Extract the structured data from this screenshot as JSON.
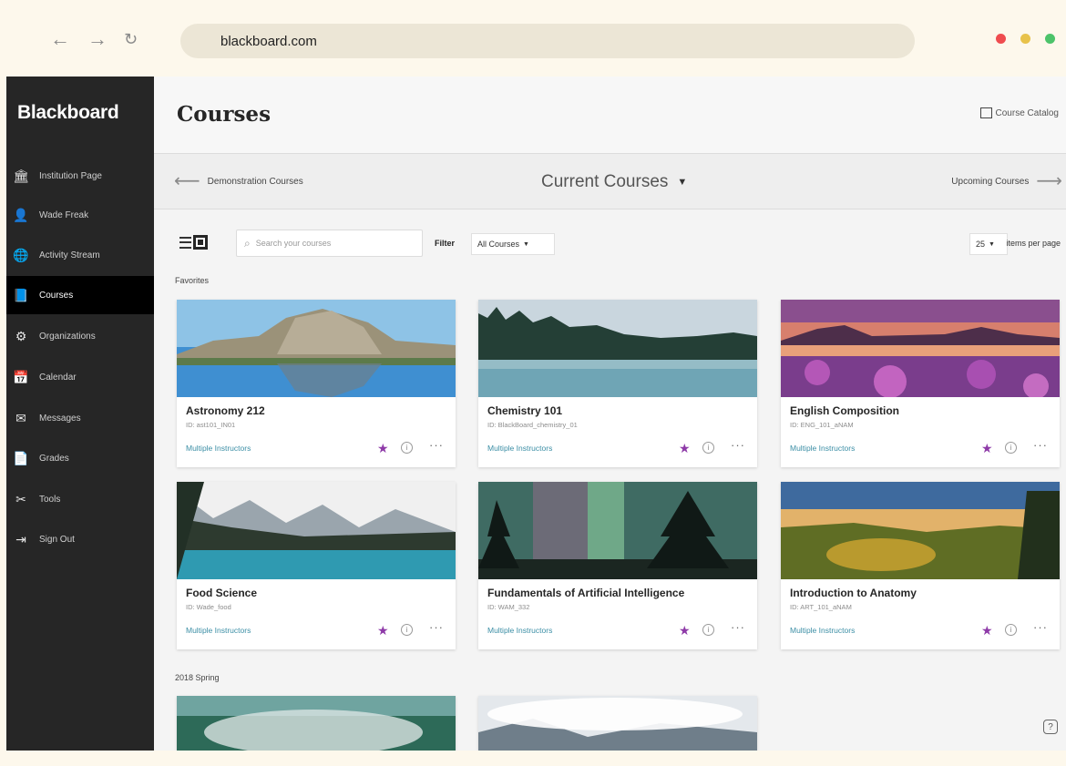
{
  "browser": {
    "url": "blackboard.com",
    "back_icon": "←",
    "forward_icon": "→",
    "reload_icon": "↻",
    "dot_colors": [
      "#ef4c4f",
      "#e8c24a",
      "#4cc36a"
    ]
  },
  "sidebar": {
    "brand": "Blackboard",
    "items": [
      {
        "label": "Institution Page",
        "icon": "🏛"
      },
      {
        "label": "Wade Freak",
        "icon": "👤"
      },
      {
        "label": "Activity Stream",
        "icon": "🌐"
      },
      {
        "label": "Courses",
        "icon": "📘"
      },
      {
        "label": "Organizations",
        "icon": "⚙"
      },
      {
        "label": "Calendar",
        "icon": "📅"
      },
      {
        "label": "Messages",
        "icon": "✉"
      },
      {
        "label": "Grades",
        "icon": "📄"
      },
      {
        "label": "Tools",
        "icon": "✂"
      },
      {
        "label": "Sign Out",
        "icon": "⇥"
      }
    ],
    "active_index": 3
  },
  "header": {
    "title": "Courses",
    "catalog_label": "Course Catalog"
  },
  "termbar": {
    "prev_label": "Demonstration Courses",
    "current_label": "Current Courses",
    "next_label": "Upcoming Courses"
  },
  "toolbar": {
    "search_placeholder": "Search your courses",
    "filter_label": "Filter",
    "filter_value": "All Courses",
    "per_page_value": "25",
    "per_page_label": "items per page"
  },
  "sections": [
    {
      "label": "Favorites"
    },
    {
      "label": "2018 Spring"
    }
  ],
  "courses": [
    {
      "title": "Astronomy 212",
      "id": "ID: ast101_IN01",
      "instructors": "Multiple Instructors",
      "favorite": true
    },
    {
      "title": "Chemistry 101",
      "id": "ID: BlackBoard_chemistry_01",
      "instructors": "Multiple Instructors",
      "favorite": true
    },
    {
      "title": "English Composition",
      "id": "ID: ENG_101_aNAM",
      "instructors": "Multiple Instructors",
      "favorite": true
    },
    {
      "title": "Food Science",
      "id": "ID: Wade_food",
      "instructors": "Multiple Instructors",
      "favorite": true
    },
    {
      "title": "Fundamentals of Artificial Intelligence",
      "id": "ID: WAM_332",
      "instructors": "Multiple Instructors",
      "favorite": true
    },
    {
      "title": "Introduction to Anatomy",
      "id": "ID: ART_101_aNAM",
      "instructors": "Multiple Instructors",
      "favorite": true
    }
  ],
  "card_actions": {
    "star": "★",
    "info": "i",
    "more": "···"
  },
  "help_icon": "?"
}
